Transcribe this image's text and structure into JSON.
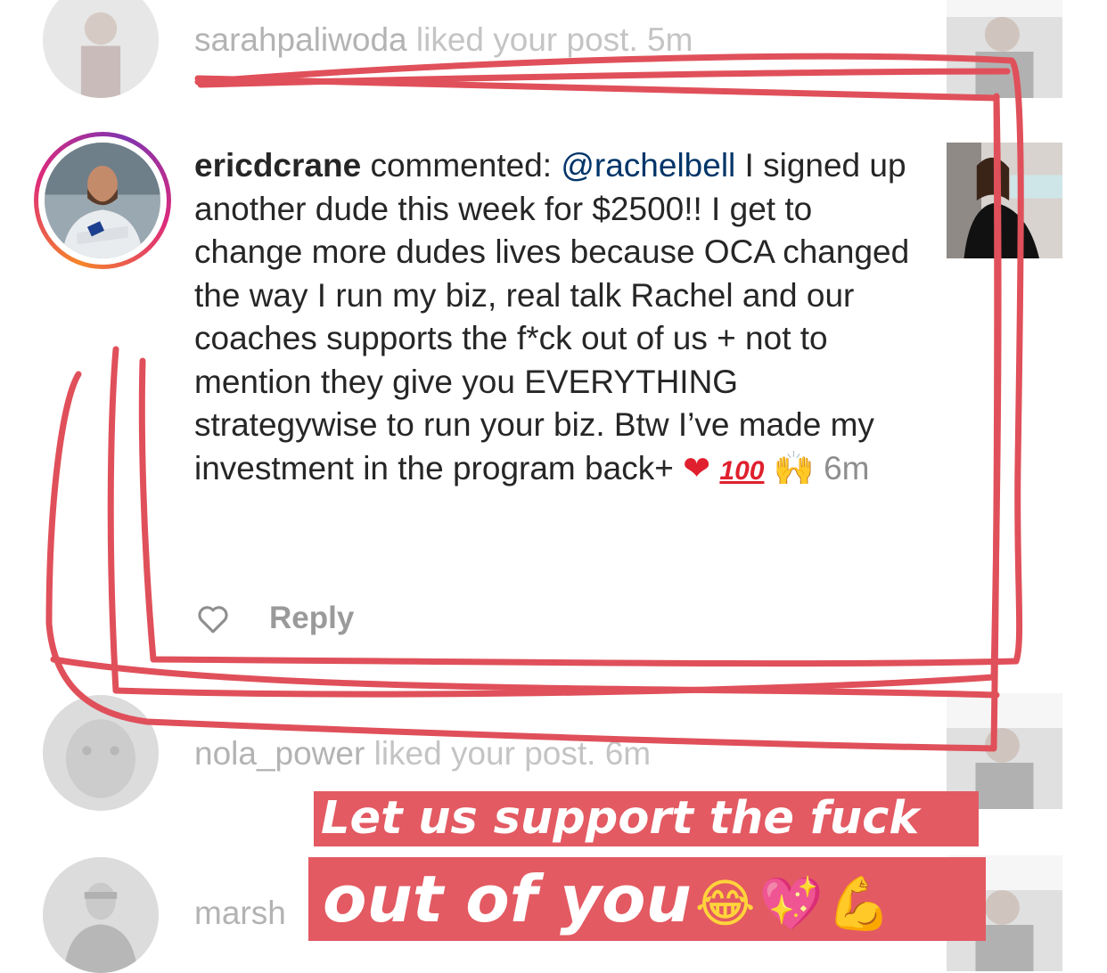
{
  "notifications": [
    {
      "username": "sarahpaliwoda",
      "text": " liked your post.",
      "time": " 5m"
    },
    {
      "username": "ericdcrane",
      "action": " commented: ",
      "mention": "@rachelbell",
      "comment": " I signed up another dude this week for $2500!! I get to change more dudes lives because OCA changed the way I run my biz, real talk Rachel and our coaches supports the f*ck out of us + not to mention they give you EVERYTHING strategywise to run your biz.  Btw I’ve made my investment in the program back+ ",
      "emojis": {
        "heart": "❤",
        "hundred": "100",
        "raised_hands": "🙌"
      },
      "time": " 6m",
      "reply_label": "Reply"
    },
    {
      "username": "nola_power",
      "text": " liked your post.",
      "time": " 6m"
    },
    {
      "username_partial": "marsh"
    }
  ],
  "overlay": {
    "line1": "Let us support the fuck",
    "line2": "out of you",
    "line2_emojis": {
      "laugh": "😂",
      "sparkle_heart": "💖",
      "muscle": "💪"
    },
    "banner_color": "#e35a62",
    "scribble_color": "#e0505a"
  },
  "colors": {
    "mention": "#003569",
    "timestamp": "#8e8e8e",
    "ring_gradient": [
      "#f58529",
      "#dd2a7b",
      "#8134af"
    ]
  }
}
